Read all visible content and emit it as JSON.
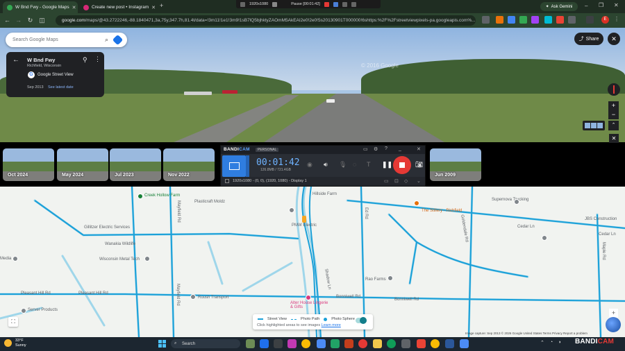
{
  "browser": {
    "tabs": [
      {
        "title": "W Bnd Fwy - Google Maps",
        "active": true,
        "favicon_color": "#34a853"
      },
      {
        "title": "Create new post • Instagram",
        "active": false,
        "favicon_color": "#d62976"
      }
    ],
    "url_host": "google.com",
    "url_rest": "/maps/@43.2722246,-88.1840471,3a,75y,347.7h,81.4t/data=!3m11!1e1!3m9!1sB7lQ5bjhktyZAOmM5AkEAI2e0!2e0!5s20130901T000000!6shttps:%2F%2Fstreetviewpixels-pa.googleapis.com%...",
    "ask_gemini": "Ask Gemini",
    "profile_letter": "E"
  },
  "capture_bar": {
    "resolution": "1920x1080",
    "pause_label": "Pause [00:01:42]"
  },
  "search": {
    "placeholder": "Search Google Maps"
  },
  "place_card": {
    "title": "W Bnd Fwy",
    "subtitle": "Richfield, Wisconsin",
    "source": "Google Street View",
    "date": "Sep 2013",
    "latest_link": "See latest date"
  },
  "share_label": "Share",
  "street_watermark": "© 2016 Google",
  "timeline": [
    "Oct 2024",
    "May 2024",
    "Jul 2023",
    "Nov 2022",
    "Jun 2009"
  ],
  "bandicam": {
    "brand_a": "BANDI",
    "brand_b": "CAM",
    "edition": "PERSONAL",
    "timer": "00:01:42",
    "size": "126.8MB / 721.4GB",
    "capture_info": "1920x1080 - (0, 0), (1920, 1080) - Display 1"
  },
  "map_labels": [
    {
      "text": "Creek Hollow Farm",
      "kind": "g"
    },
    {
      "text": "Plasticraft Moldz",
      "kind": "n"
    },
    {
      "text": "Hillside Farm",
      "kind": "n"
    },
    {
      "text": "The Stillery - Richfield",
      "kind": "o"
    },
    {
      "text": "Supernova Trucking",
      "kind": "n"
    },
    {
      "text": "JBS Construction",
      "kind": "n"
    },
    {
      "text": "Cedar Ln",
      "kind": "n"
    },
    {
      "text": "Cedar Ln",
      "kind": "n"
    },
    {
      "text": "Gillitzer Electric Services",
      "kind": "n"
    },
    {
      "text": "PMW Electric",
      "kind": "n"
    },
    {
      "text": "Wanakia Wildlife",
      "kind": "n"
    },
    {
      "text": "Wisconsin Metal Tech",
      "kind": "n"
    },
    {
      "text": "Media",
      "kind": "n"
    },
    {
      "text": "Rao Farms",
      "kind": "n"
    },
    {
      "text": "Pleasant Hill Rd",
      "kind": "n"
    },
    {
      "text": "Pleasant Hill Rd",
      "kind": "n"
    },
    {
      "text": "Roush Transport",
      "kind": "n"
    },
    {
      "text": "Bonniwell Rd",
      "kind": "n"
    },
    {
      "text": "Bonniwell Rd",
      "kind": "n"
    },
    {
      "text": "Alter House Lingerie & Gifts",
      "kind": "p"
    },
    {
      "text": "Server Products",
      "kind": "n"
    },
    {
      "text": "Maple Rd",
      "kind": "n"
    },
    {
      "text": "Goldendale Rd",
      "kind": "n"
    },
    {
      "text": "Shadow Ln",
      "kind": "n"
    },
    {
      "text": "Mayfield Rd",
      "kind": "n"
    },
    {
      "text": "Mayfield Rd",
      "kind": "n"
    },
    {
      "text": "Ed Rd",
      "kind": "n"
    }
  ],
  "map_legend": {
    "items": [
      "Street View",
      "Photo Path",
      "Photo Sphere"
    ],
    "hint": "Click highlighted areas to see images",
    "learn_more": "Learn more"
  },
  "attribution": "Image capture: Sep 2013   © 2026 Google   United States   Terms   Privacy   Report a problem",
  "taskbar": {
    "temp": "33°F",
    "condition": "Sunny",
    "search_placeholder": "Search",
    "watermark_a": "BANDI",
    "watermark_b": "CAM"
  }
}
